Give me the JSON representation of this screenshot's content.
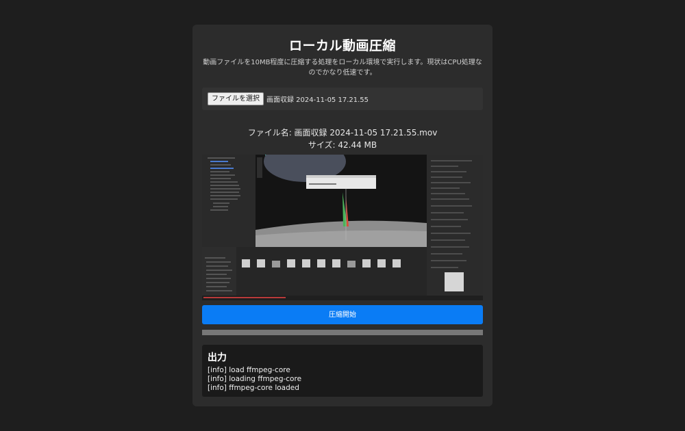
{
  "page": {
    "title": "ローカル動画圧縮",
    "description": "動画ファイルを10MB程度に圧縮する処理をローカル環境で実行します。現状はCPU処理なのでかなり低速です。"
  },
  "file_input": {
    "button_label": "ファイルを選択",
    "selected_name": "画面収録 2024-11-05 17.21.55"
  },
  "file_info": {
    "name_line": "ファイル名: 画面収録 2024-11-05 17.21.55.mov",
    "size_line": "サイズ: 42.44 MB"
  },
  "compress_button": {
    "label": "圧縮開始"
  },
  "progress": {
    "value": 1.0
  },
  "output": {
    "title": "出力",
    "logs": [
      "[info] load ffmpeg-core",
      "[info] loading ffmpeg-core",
      "[info] ffmpeg-core loaded"
    ]
  },
  "colors": {
    "background": "#1e1e1e",
    "card": "#2c2c2c",
    "accent": "#0a7cf5",
    "output_bg": "#1a1a1a"
  }
}
